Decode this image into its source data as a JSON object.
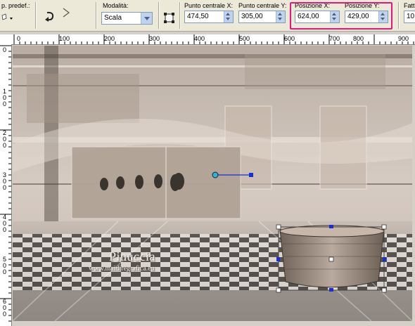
{
  "toolbar": {
    "preset_label": "p. predef.:",
    "mode_label": "Modalità:",
    "mode_value": "Scala",
    "center_x_label": "Punto centrale X:",
    "center_x_value": "474,50",
    "center_y_label": "Punto centrale Y:",
    "center_y_value": "305,00",
    "pos_x_label": "Posizione X:",
    "pos_x_value": "624,00",
    "pos_y_label": "Posizione Y:",
    "pos_y_value": "429,00",
    "factor_label": "Fatt",
    "factor_value": "10",
    "highlight_color": "#e8177d"
  },
  "ruler": {
    "h_ticks": [
      "0",
      "100",
      "200",
      "300",
      "400",
      "500",
      "600",
      "700",
      "800",
      "900"
    ],
    "v_ticks": [
      "0",
      "1 0 0",
      "2 0 0",
      "3 0 0",
      "4 0 0",
      "5 0 0",
      "6 0 0"
    ]
  },
  "canvas": {
    "watermark_title": "Pinuccia",
    "watermark_url": "www.maidiregrafica.eu",
    "base_color": "#bfb2a6",
    "accent_color": "#1a2fd0"
  }
}
